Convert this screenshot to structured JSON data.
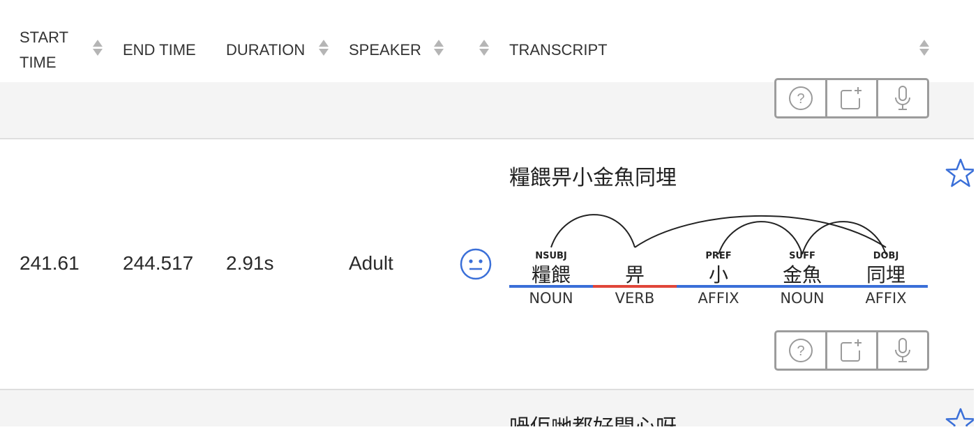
{
  "columns": {
    "start_time_line1": "START",
    "start_time_line2": "TIME",
    "end_time": "END TIME",
    "duration": "DURATION",
    "speaker": "SPEAKER",
    "transcript": "TRANSCRIPT"
  },
  "rows": [
    {
      "start_time": "241.61",
      "end_time": "244.517",
      "duration": "2.91s",
      "speaker": "Adult",
      "sentiment_icon": "neutral-face-icon",
      "utterance": "糧餵畀小金魚同埋",
      "tokens": [
        {
          "word": "糧餵",
          "dep": "NSUBJ",
          "pos": "NOUN",
          "pos_color": "#3a6fd8"
        },
        {
          "word": "畀",
          "dep": "",
          "pos": "VERB",
          "pos_color": "#e0463a"
        },
        {
          "word": "小",
          "dep": "PREF",
          "pos": "AFFIX",
          "pos_color": "#3a6fd8"
        },
        {
          "word": "金魚",
          "dep": "SUFF",
          "pos": "NOUN",
          "pos_color": "#3a6fd8"
        },
        {
          "word": "同埋",
          "dep": "DOBJ",
          "pos": "AFFIX",
          "pos_color": "#3a6fd8"
        }
      ]
    },
    {
      "utterance": "喎佢哋都好開心呀"
    }
  ],
  "actions": [
    "question-icon",
    "add-note-icon",
    "microphone-icon"
  ],
  "colors": {
    "accent": "#3a6fd8",
    "verb": "#e0463a",
    "row_alt": "#f4f4f4"
  }
}
